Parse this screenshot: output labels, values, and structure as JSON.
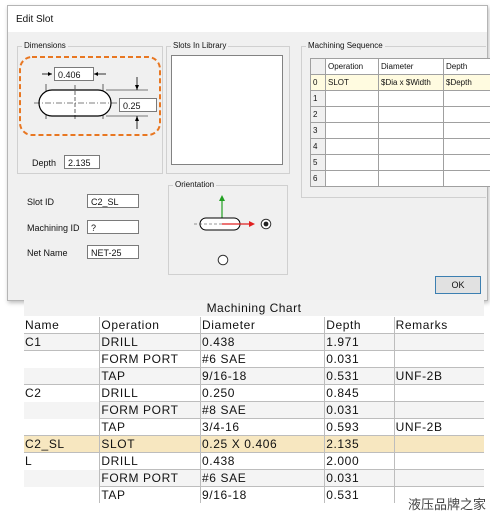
{
  "dialog": {
    "title": "Edit Slot",
    "dimensions": {
      "label": "Dimensions",
      "width_value": "0.406",
      "dia_value": "0.25",
      "depth_label": "Depth",
      "depth_value": "2.135"
    },
    "slots_library": {
      "label": "Slots In Library"
    },
    "orientation": {
      "label": "Orientation"
    },
    "slot_id": {
      "label": "Slot ID",
      "value": "C2_SL"
    },
    "machining_id": {
      "label": "Machining ID",
      "value": "?"
    },
    "net_name": {
      "label": "Net Name",
      "value": "NET-25"
    },
    "sequence": {
      "label": "Machining Sequence",
      "headers": [
        "Operation",
        "Diameter",
        "Depth"
      ],
      "rows": [
        {
          "idx": "0",
          "operation": "SLOT",
          "diameter": "$Dia x $Width",
          "depth": "$Depth"
        },
        {
          "idx": "1",
          "operation": "",
          "diameter": "",
          "depth": ""
        },
        {
          "idx": "2",
          "operation": "",
          "diameter": "",
          "depth": ""
        },
        {
          "idx": "3",
          "operation": "",
          "diameter": "",
          "depth": ""
        },
        {
          "idx": "4",
          "operation": "",
          "diameter": "",
          "depth": ""
        },
        {
          "idx": "5",
          "operation": "",
          "diameter": "",
          "depth": ""
        },
        {
          "idx": "6",
          "operation": "",
          "diameter": "",
          "depth": ""
        }
      ]
    },
    "ok_label": "OK"
  },
  "chart": {
    "title": "Machining Chart",
    "headers": [
      "Name",
      "Operation",
      "Diameter",
      "Depth",
      "Remarks"
    ],
    "rows": [
      [
        "C1",
        "DRILL",
        "0.438",
        "1.971",
        ""
      ],
      [
        "",
        "FORM PORT",
        "#6 SAE",
        "0.031",
        ""
      ],
      [
        "",
        "TAP",
        "9/16-18",
        "0.531",
        "UNF-2B"
      ],
      [
        "C2",
        "DRILL",
        "0.250",
        "0.845",
        ""
      ],
      [
        "",
        "FORM PORT",
        "#8 SAE",
        "0.031",
        ""
      ],
      [
        "",
        "TAP",
        "3/4-16",
        "0.593",
        "UNF-2B"
      ],
      [
        "C2_SL",
        "SLOT",
        "0.25 X 0.406",
        "2.135",
        ""
      ],
      [
        "L",
        "DRILL",
        "0.438",
        "2.000",
        ""
      ],
      [
        "",
        "FORM PORT",
        "#6 SAE",
        "0.031",
        ""
      ],
      [
        "",
        "TAP",
        "9/16-18",
        "0.531",
        ""
      ]
    ],
    "highlight_color": "#f7e7c0"
  },
  "watermark": "液压品牌之家",
  "colors": {
    "accent_dashed": "#e87722",
    "axis_green": "#22a022",
    "axis_red": "#e02020"
  }
}
